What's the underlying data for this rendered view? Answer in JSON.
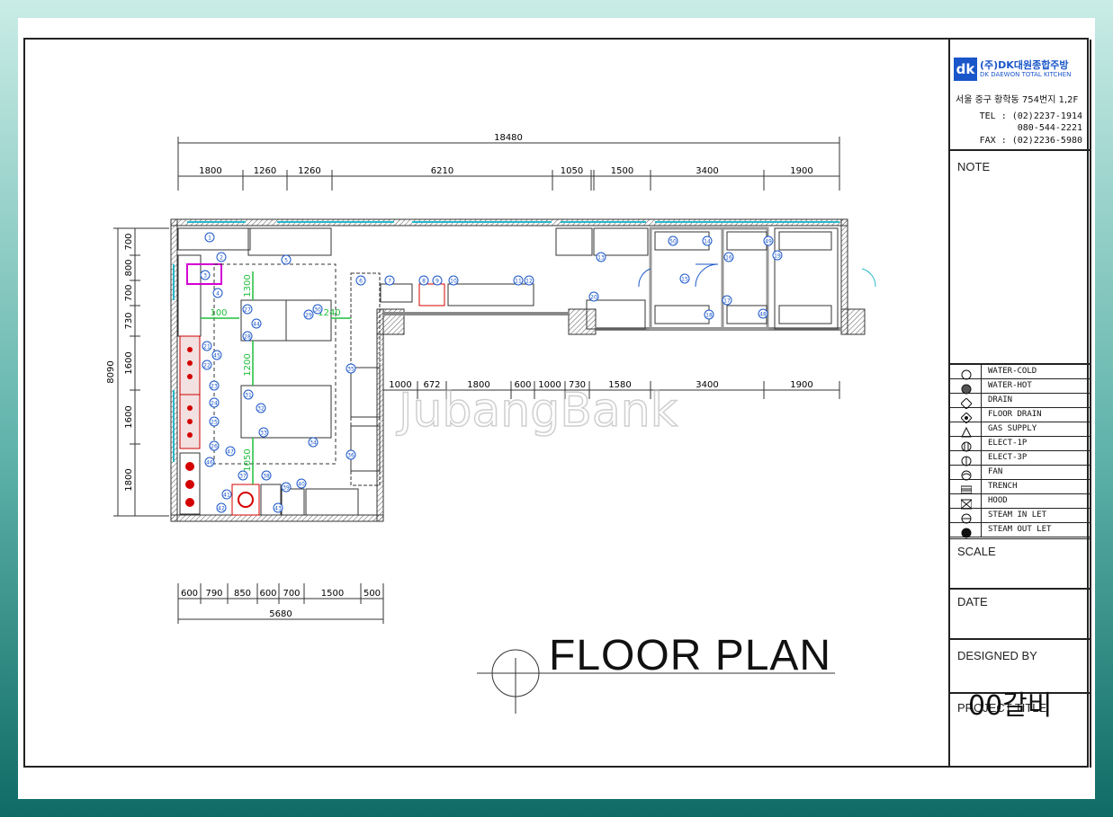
{
  "drawing": {
    "title": "FLOOR PLAN",
    "watermark": "JubangBank"
  },
  "company": {
    "logo_mark": "dk",
    "name": "(주)DK대원종합주방",
    "name_en": "DK DAEWON TOTAL KITCHEN",
    "address": "서울 중구 황학동 754번지 1,2F",
    "tel_label": "TEL : (02)2237-1914",
    "tel_2": "080-544-2221",
    "fax_label": "FAX : (02)2236-5980"
  },
  "title_block": {
    "note_label": "NOTE",
    "scale_label": "SCALE",
    "date_label": "DATE",
    "designed_by_label": "DESIGNED BY",
    "project_title_label": "PROJECT TITLE",
    "project_title": "00갈비"
  },
  "legend": [
    {
      "icon": "circle-icon",
      "label": "WATER-COLD"
    },
    {
      "icon": "hatched-circle-icon",
      "label": "WATER-HOT"
    },
    {
      "icon": "diamond-icon",
      "label": "DRAIN"
    },
    {
      "icon": "floor-drain-icon",
      "label": "FLOOR DRAIN"
    },
    {
      "icon": "triangle-icon",
      "label": "GAS SUPPLY"
    },
    {
      "icon": "elect-1p-icon",
      "label": "ELECT-1P"
    },
    {
      "icon": "elect-3p-icon",
      "label": "ELECT-3P"
    },
    {
      "icon": "fan-icon",
      "label": "FAN"
    },
    {
      "icon": "trench-icon",
      "label": "TRENCH"
    },
    {
      "icon": "hood-icon",
      "label": "HOOD"
    },
    {
      "icon": "steam-inlet-icon",
      "label": "STEAM IN LET"
    },
    {
      "icon": "steam-outlet-icon",
      "label": "STEAM OUT LET"
    }
  ],
  "dimensions": {
    "overall_width": "18480",
    "top_segments": [
      "1800",
      "1260",
      "1260",
      "6210",
      "1050",
      "1500",
      "3400",
      "1900"
    ],
    "mid_segments": [
      "1000",
      "672",
      "1800",
      "600",
      "1000",
      "730",
      "1580",
      "3400",
      "1900"
    ],
    "bottom_segments": [
      "600",
      "790",
      "850",
      "600",
      "700",
      "1500",
      "500"
    ],
    "bottom_total": "5680",
    "overall_height": "8090",
    "left_segments": [
      "700",
      "800",
      "700",
      "730",
      "1600",
      "1600",
      "1800"
    ],
    "inner_green": [
      "1300",
      "1200",
      "1050",
      "100",
      "1240"
    ]
  },
  "equipment_tags": [
    "1",
    "2",
    "3",
    "4",
    "5",
    "6",
    "7",
    "8",
    "9",
    "10",
    "11",
    "12",
    "13",
    "14",
    "15",
    "16",
    "17",
    "18",
    "19",
    "20",
    "21",
    "22",
    "23",
    "24",
    "25",
    "26",
    "27",
    "28",
    "29",
    "30",
    "31",
    "32",
    "33",
    "34",
    "35",
    "36",
    "37",
    "38",
    "39",
    "40",
    "41",
    "42",
    "43",
    "44",
    "45",
    "46",
    "47",
    "48",
    "49",
    "50"
  ]
}
